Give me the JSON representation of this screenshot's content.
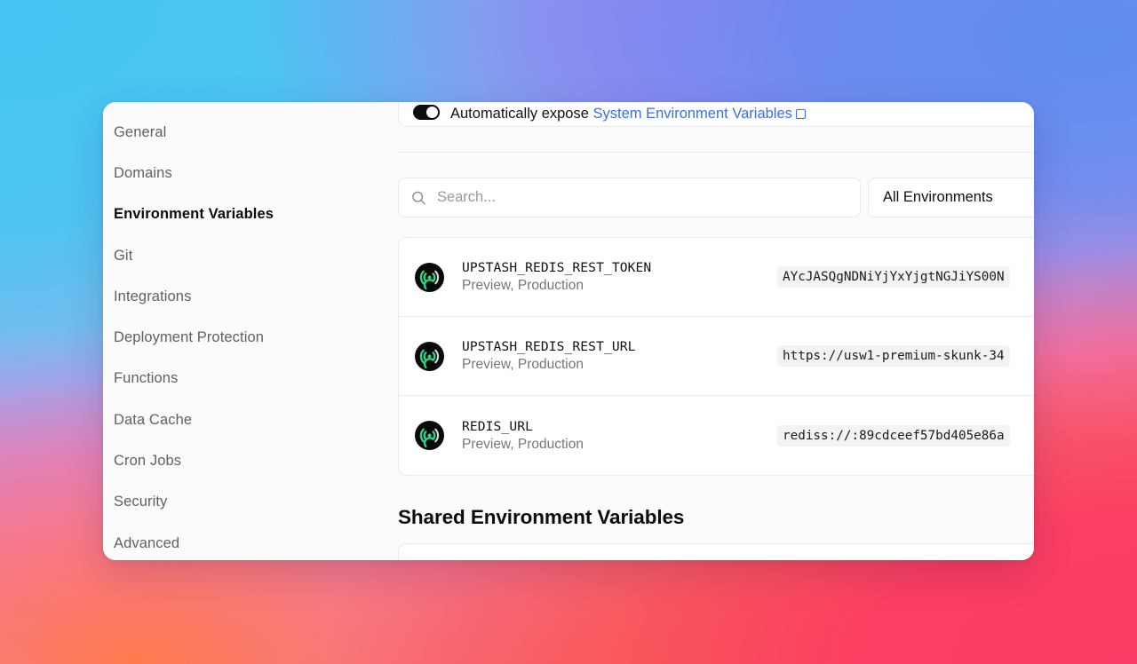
{
  "background": {
    "colors": [
      "#46c6f2",
      "#a07bf0",
      "#5f8df0",
      "#f46ee0",
      "#fb3b63",
      "#ff7a4d"
    ]
  },
  "sidebar": {
    "items": [
      {
        "label": "General",
        "active": false
      },
      {
        "label": "Domains",
        "active": false
      },
      {
        "label": "Environment Variables",
        "active": true
      },
      {
        "label": "Git",
        "active": false
      },
      {
        "label": "Integrations",
        "active": false
      },
      {
        "label": "Deployment Protection",
        "active": false
      },
      {
        "label": "Functions",
        "active": false
      },
      {
        "label": "Data Cache",
        "active": false
      },
      {
        "label": "Cron Jobs",
        "active": false
      },
      {
        "label": "Security",
        "active": false
      },
      {
        "label": "Advanced",
        "active": false
      }
    ]
  },
  "expose": {
    "label": "Automatically expose",
    "link_label": "System Environment Variables",
    "toggle_on": true,
    "toggle_color": "#0d0d0d",
    "link_color": "#3b6fe0"
  },
  "search": {
    "placeholder": "Search...",
    "value": "",
    "icon": "search-icon"
  },
  "env_filter": {
    "label": "All Environments"
  },
  "env_vars": [
    {
      "provider_icon": "upstash-logo-icon",
      "key": "UPSTASH_REDIS_REST_TOKEN",
      "scope": "Preview, Production",
      "value": "AYcJASQgNDNiYjYxYjgtNGJiYS00N"
    },
    {
      "provider_icon": "upstash-logo-icon",
      "key": "UPSTASH_REDIS_REST_URL",
      "scope": "Preview, Production",
      "value": "https://usw1-premium-skunk-34"
    },
    {
      "provider_icon": "upstash-logo-icon",
      "key": "REDIS_URL",
      "scope": "Preview, Production",
      "value": "rediss://:89cdceef57bd405e86a"
    }
  ],
  "shared_section": {
    "heading": "Shared Environment Variables"
  }
}
